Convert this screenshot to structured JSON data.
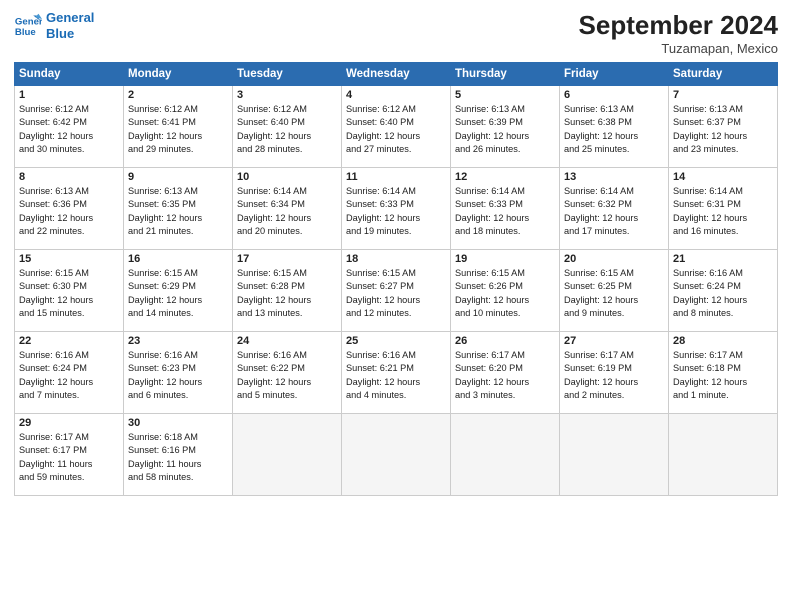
{
  "header": {
    "logo_line1": "General",
    "logo_line2": "Blue",
    "month": "September 2024",
    "location": "Tuzamapan, Mexico"
  },
  "weekdays": [
    "Sunday",
    "Monday",
    "Tuesday",
    "Wednesday",
    "Thursday",
    "Friday",
    "Saturday"
  ],
  "weeks": [
    [
      {
        "day": "1",
        "info": "Sunrise: 6:12 AM\nSunset: 6:42 PM\nDaylight: 12 hours\nand 30 minutes."
      },
      {
        "day": "2",
        "info": "Sunrise: 6:12 AM\nSunset: 6:41 PM\nDaylight: 12 hours\nand 29 minutes."
      },
      {
        "day": "3",
        "info": "Sunrise: 6:12 AM\nSunset: 6:40 PM\nDaylight: 12 hours\nand 28 minutes."
      },
      {
        "day": "4",
        "info": "Sunrise: 6:12 AM\nSunset: 6:40 PM\nDaylight: 12 hours\nand 27 minutes."
      },
      {
        "day": "5",
        "info": "Sunrise: 6:13 AM\nSunset: 6:39 PM\nDaylight: 12 hours\nand 26 minutes."
      },
      {
        "day": "6",
        "info": "Sunrise: 6:13 AM\nSunset: 6:38 PM\nDaylight: 12 hours\nand 25 minutes."
      },
      {
        "day": "7",
        "info": "Sunrise: 6:13 AM\nSunset: 6:37 PM\nDaylight: 12 hours\nand 23 minutes."
      }
    ],
    [
      {
        "day": "8",
        "info": "Sunrise: 6:13 AM\nSunset: 6:36 PM\nDaylight: 12 hours\nand 22 minutes."
      },
      {
        "day": "9",
        "info": "Sunrise: 6:13 AM\nSunset: 6:35 PM\nDaylight: 12 hours\nand 21 minutes."
      },
      {
        "day": "10",
        "info": "Sunrise: 6:14 AM\nSunset: 6:34 PM\nDaylight: 12 hours\nand 20 minutes."
      },
      {
        "day": "11",
        "info": "Sunrise: 6:14 AM\nSunset: 6:33 PM\nDaylight: 12 hours\nand 19 minutes."
      },
      {
        "day": "12",
        "info": "Sunrise: 6:14 AM\nSunset: 6:33 PM\nDaylight: 12 hours\nand 18 minutes."
      },
      {
        "day": "13",
        "info": "Sunrise: 6:14 AM\nSunset: 6:32 PM\nDaylight: 12 hours\nand 17 minutes."
      },
      {
        "day": "14",
        "info": "Sunrise: 6:14 AM\nSunset: 6:31 PM\nDaylight: 12 hours\nand 16 minutes."
      }
    ],
    [
      {
        "day": "15",
        "info": "Sunrise: 6:15 AM\nSunset: 6:30 PM\nDaylight: 12 hours\nand 15 minutes."
      },
      {
        "day": "16",
        "info": "Sunrise: 6:15 AM\nSunset: 6:29 PM\nDaylight: 12 hours\nand 14 minutes."
      },
      {
        "day": "17",
        "info": "Sunrise: 6:15 AM\nSunset: 6:28 PM\nDaylight: 12 hours\nand 13 minutes."
      },
      {
        "day": "18",
        "info": "Sunrise: 6:15 AM\nSunset: 6:27 PM\nDaylight: 12 hours\nand 12 minutes."
      },
      {
        "day": "19",
        "info": "Sunrise: 6:15 AM\nSunset: 6:26 PM\nDaylight: 12 hours\nand 10 minutes."
      },
      {
        "day": "20",
        "info": "Sunrise: 6:15 AM\nSunset: 6:25 PM\nDaylight: 12 hours\nand 9 minutes."
      },
      {
        "day": "21",
        "info": "Sunrise: 6:16 AM\nSunset: 6:24 PM\nDaylight: 12 hours\nand 8 minutes."
      }
    ],
    [
      {
        "day": "22",
        "info": "Sunrise: 6:16 AM\nSunset: 6:24 PM\nDaylight: 12 hours\nand 7 minutes."
      },
      {
        "day": "23",
        "info": "Sunrise: 6:16 AM\nSunset: 6:23 PM\nDaylight: 12 hours\nand 6 minutes."
      },
      {
        "day": "24",
        "info": "Sunrise: 6:16 AM\nSunset: 6:22 PM\nDaylight: 12 hours\nand 5 minutes."
      },
      {
        "day": "25",
        "info": "Sunrise: 6:16 AM\nSunset: 6:21 PM\nDaylight: 12 hours\nand 4 minutes."
      },
      {
        "day": "26",
        "info": "Sunrise: 6:17 AM\nSunset: 6:20 PM\nDaylight: 12 hours\nand 3 minutes."
      },
      {
        "day": "27",
        "info": "Sunrise: 6:17 AM\nSunset: 6:19 PM\nDaylight: 12 hours\nand 2 minutes."
      },
      {
        "day": "28",
        "info": "Sunrise: 6:17 AM\nSunset: 6:18 PM\nDaylight: 12 hours\nand 1 minute."
      }
    ],
    [
      {
        "day": "29",
        "info": "Sunrise: 6:17 AM\nSunset: 6:17 PM\nDaylight: 11 hours\nand 59 minutes."
      },
      {
        "day": "30",
        "info": "Sunrise: 6:18 AM\nSunset: 6:16 PM\nDaylight: 11 hours\nand 58 minutes."
      },
      {
        "day": "",
        "info": "",
        "empty": true
      },
      {
        "day": "",
        "info": "",
        "empty": true
      },
      {
        "day": "",
        "info": "",
        "empty": true
      },
      {
        "day": "",
        "info": "",
        "empty": true
      },
      {
        "day": "",
        "info": "",
        "empty": true
      }
    ]
  ]
}
